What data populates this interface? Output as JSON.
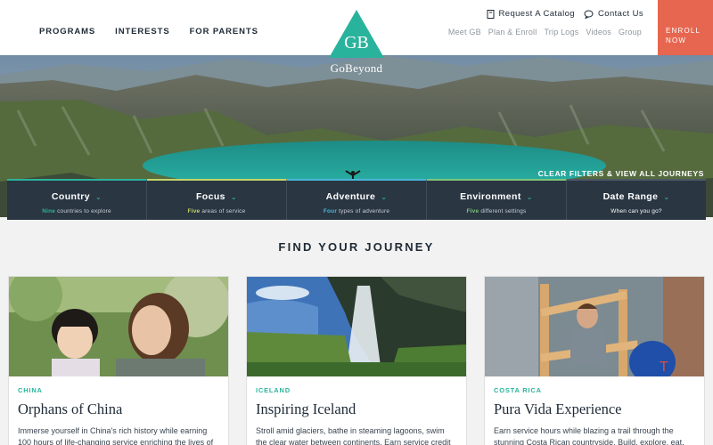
{
  "nav": {
    "left": [
      "PROGRAMS",
      "INTERESTS",
      "FOR PARENTS"
    ],
    "utility": [
      {
        "label": "Request A Catalog",
        "icon": "catalog-icon"
      },
      {
        "label": "Contact Us",
        "icon": "chat-icon"
      }
    ],
    "right": [
      "Meet GB",
      "Plan & Enroll",
      "Trip Logs",
      "Videos",
      "Group"
    ],
    "enroll": "ENROLL NOW"
  },
  "logo": {
    "monogram": "GB",
    "name": "GoBeyond"
  },
  "hero": {
    "clear_filters": "CLEAR FILTERS & VIEW ALL JOURNEYS"
  },
  "filters": [
    {
      "title": "Country",
      "highlight": "Nine",
      "subtitle": " countries to explore",
      "color": "#2ab39c"
    },
    {
      "title": "Focus",
      "highlight": "Five",
      "subtitle": " areas of service",
      "color": "#c4d46b"
    },
    {
      "title": "Adventure",
      "highlight": "Four",
      "subtitle": " types of adventure",
      "color": "#4ab6d9"
    },
    {
      "title": "Environment",
      "highlight": "Five",
      "subtitle": " different settings",
      "color": "#7fc47a"
    },
    {
      "title": "Date Range",
      "highlight": "",
      "subtitle": "When can you go?",
      "color": "#ffffff"
    }
  ],
  "section": {
    "title": "FIND YOUR JOURNEY"
  },
  "cards": [
    {
      "country": "CHINA",
      "title": "Orphans of China",
      "desc": "Immerse yourself in China's rich history while earning 100 hours of life-changing service enriching the lives of"
    },
    {
      "country": "ICELAND",
      "title": "Inspiring Iceland",
      "desc": "Stroll amid glaciers, bathe in steaming lagoons, swim the clear water between continents. Earn service credit"
    },
    {
      "country": "COSTA RICA",
      "title": "Pura Vida Experience",
      "desc": "Earn service hours while blazing a trail through the stunning Costa Rican countryside. Build, explore, eat,"
    }
  ],
  "colors": {
    "accent": "#2ab39c",
    "enroll": "#e7664f",
    "navy": "#2a3642"
  }
}
